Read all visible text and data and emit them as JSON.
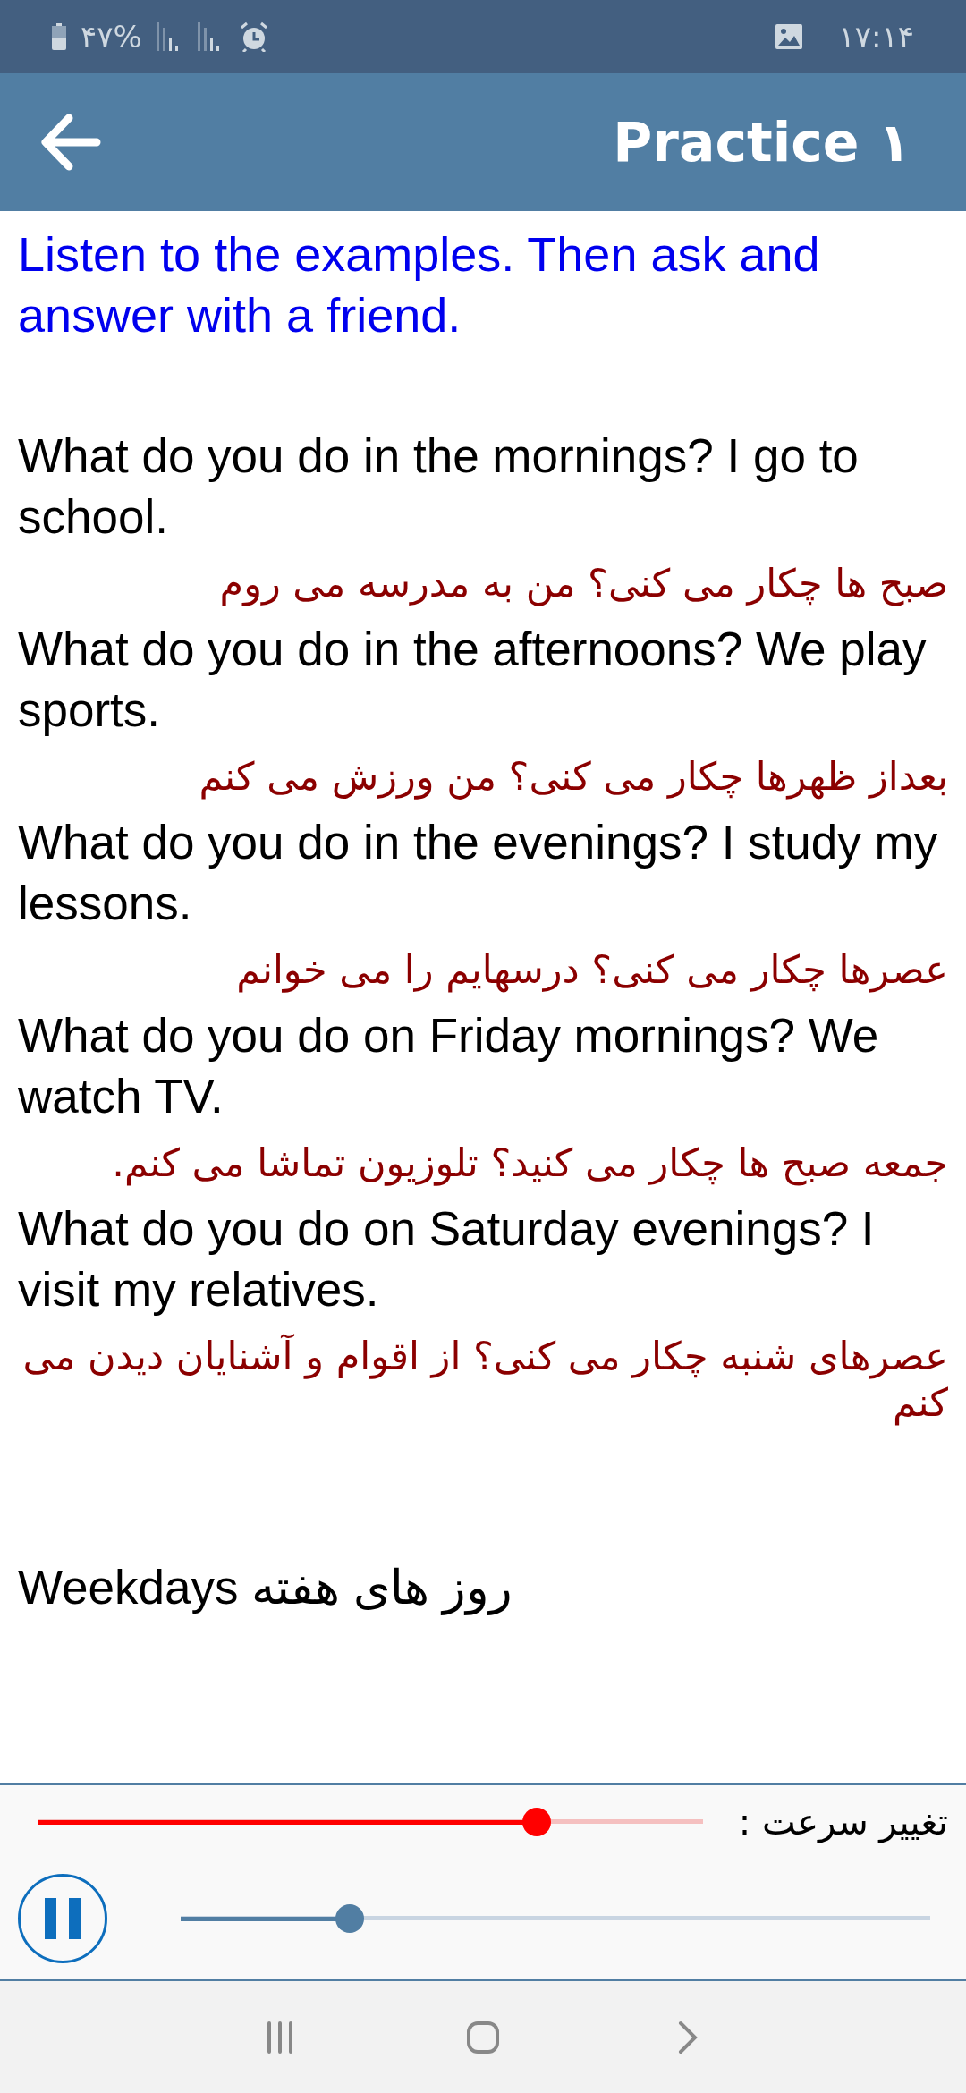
{
  "status_bar": {
    "battery": "۴۷%",
    "time": "۱۷:۱۴"
  },
  "app_bar": {
    "title": "Practice ۱"
  },
  "instruction": "Listen to the examples. Then ask and answer with a friend.",
  "examples": [
    {
      "english": "What do you do in the mornings? I go to school.",
      "persian": "صبح ها چکار می کنی؟ من به مدرسه می روم"
    },
    {
      "english": "What do you do in the afternoons? We play sports.",
      "persian": "بعداز ظهرها چکار می کنی؟ من ورزش می کنم"
    },
    {
      "english": "What do you do in the evenings? I study my lessons.",
      "persian": "عصرها چکار می کنی؟ درسهایم را می خوانم"
    },
    {
      "english": "What do you do on Friday mornings? We watch TV.",
      "persian": "جمعه صبح ها چکار می کنید؟ تلوزیون تماشا می کنم."
    },
    {
      "english": "What do you do on Saturday evenings? I visit my relatives.",
      "persian": "عصرهای شنبه چکار می کنی؟ از  اقوام و آشنایان دیدن می کنم"
    }
  ],
  "next_heading": "Weekdays روز های هفته",
  "player": {
    "speed_label": "تغییر سرعت :",
    "speed": {
      "level": 0.75
    },
    "playing": true,
    "progress": {
      "level": 0.225
    }
  }
}
